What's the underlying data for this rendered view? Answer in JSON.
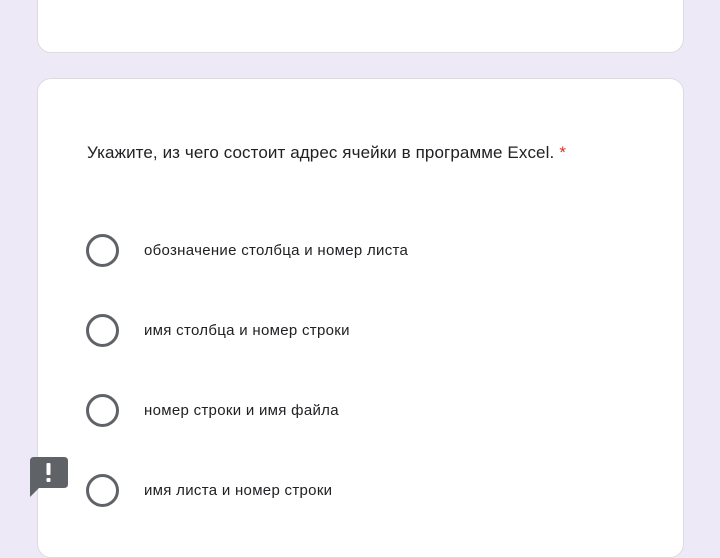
{
  "question": {
    "title": "Укажите, из чего состоит адрес ячейки в программе Excel.",
    "required_mark": "*",
    "options": [
      "обозначение столбца и номер листа",
      "имя столбца и номер строки",
      "номер строки и имя файла",
      "имя листа и номер строки"
    ],
    "selected": null
  },
  "icons": {
    "feedback": "report-problem-icon"
  },
  "colors": {
    "background": "#ede9f6",
    "card": "#ffffff",
    "radio_border": "#5f6368",
    "required": "#d93025",
    "feedback_bg": "#5f6368"
  }
}
